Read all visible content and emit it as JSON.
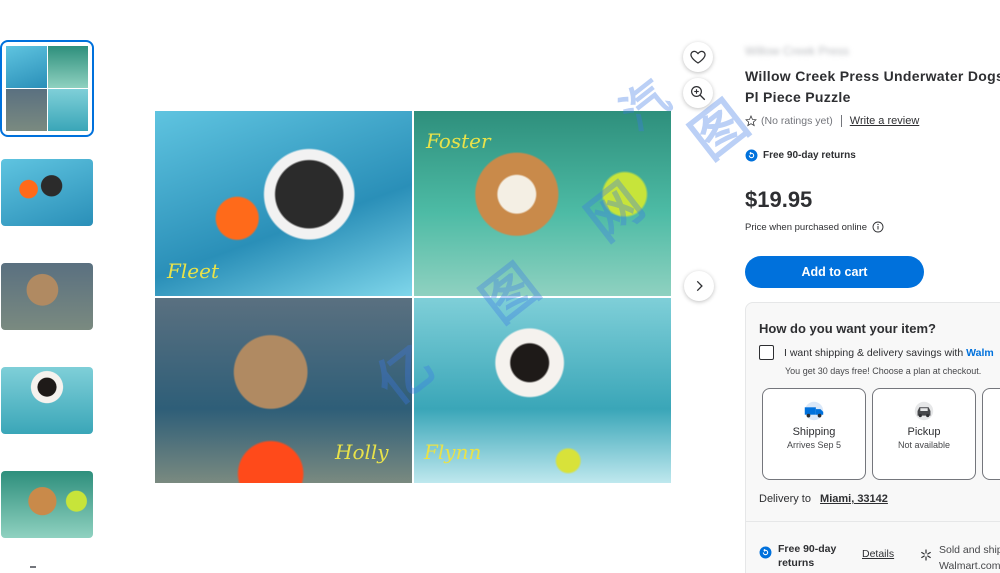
{
  "gallery": {
    "main_image_labels": [
      "Fleet",
      "Foster",
      "Holly",
      "Flynn"
    ],
    "watermark_text": "亿 图 网 图",
    "watermark_text_2": "汽"
  },
  "product": {
    "brand": "Willow Creek Press",
    "title": "Willow Creek Press Underwater Dogs: Pl Piece Puzzle",
    "rating_text": "(No ratings yet)",
    "write_review": "Write a review",
    "returns_badge": "Free 90-day returns",
    "price": "$19.95",
    "price_note": "Price when purchased online",
    "add_to_cart": "Add to cart"
  },
  "fulfillment": {
    "title": "How do you want your item?",
    "checkbox_label": "I want shipping & delivery savings with",
    "checkbox_brand": "Walm",
    "checkbox_sub": "You get 30 days free! Choose a plan at checkout.",
    "options": [
      {
        "label": "Shipping",
        "sub": "Arrives Sep 5",
        "icon": "truck-icon"
      },
      {
        "label": "Pickup",
        "sub": "Not available",
        "icon": "car-icon"
      }
    ],
    "delivery_prefix": "Delivery to",
    "delivery_location": "Miami, 33142",
    "returns_label": "Free 90-day returns",
    "details_link": "Details",
    "sold_line1": "Sold and ship",
    "sold_line2": "Walmart.com"
  },
  "colors": {
    "accent": "#0071dc",
    "text": "#2e2f32"
  }
}
